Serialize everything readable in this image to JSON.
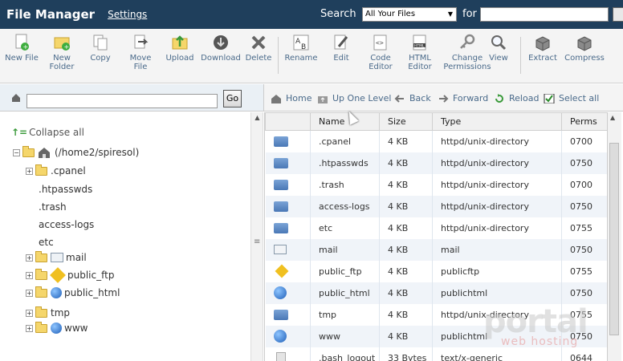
{
  "header": {
    "title": "File Manager",
    "settings": "Settings",
    "search_label": "Search",
    "search_scope": "All Your Files",
    "for_label": "for"
  },
  "toolbar": {
    "items": [
      {
        "label": "New File",
        "icon": "new-file-icon"
      },
      {
        "label": "New Folder",
        "icon": "new-folder-icon"
      },
      {
        "label": "Copy",
        "icon": "copy-icon"
      },
      {
        "label": "Move File",
        "icon": "move-icon"
      },
      {
        "label": "Upload",
        "icon": "upload-icon"
      },
      {
        "label": "Download",
        "icon": "download-icon"
      },
      {
        "label": "Delete",
        "icon": "delete-icon"
      },
      {
        "label": "Rename",
        "icon": "rename-icon"
      },
      {
        "label": "Edit",
        "icon": "edit-icon"
      },
      {
        "label": "Code Editor",
        "icon": "code-editor-icon"
      },
      {
        "label": "HTML Editor",
        "icon": "html-editor-icon"
      },
      {
        "label": "Change Permissions",
        "icon": "permissions-icon"
      },
      {
        "label": "View",
        "icon": "view-icon"
      },
      {
        "label": "Extract",
        "icon": "extract-icon"
      },
      {
        "label": "Compress",
        "icon": "compress-icon"
      }
    ]
  },
  "addressbar": {
    "go": "Go"
  },
  "nav": {
    "home": "Home",
    "up": "Up One Level",
    "back": "Back",
    "forward": "Forward",
    "reload": "Reload",
    "select_all": "Select all"
  },
  "tree": {
    "collapse_all": "Collapse all",
    "root": "(/home2/spiresol)",
    "items": [
      ".cpanel",
      ".htpasswds",
      ".trash",
      "access-logs",
      "etc",
      "mail",
      "public_ftp",
      "public_html",
      "tmp",
      "www"
    ]
  },
  "table": {
    "columns": [
      "Name",
      "Size",
      "Type",
      "Perms"
    ],
    "rows": [
      {
        "icon": "folder",
        "name": ".cpanel",
        "size": "4 KB",
        "type": "httpd/unix-directory",
        "perms": "0700"
      },
      {
        "icon": "folder",
        "name": ".htpasswds",
        "size": "4 KB",
        "type": "httpd/unix-directory",
        "perms": "0750"
      },
      {
        "icon": "folder",
        "name": ".trash",
        "size": "4 KB",
        "type": "httpd/unix-directory",
        "perms": "0700"
      },
      {
        "icon": "folder",
        "name": "access-logs",
        "size": "4 KB",
        "type": "httpd/unix-directory",
        "perms": "0750"
      },
      {
        "icon": "folder",
        "name": "etc",
        "size": "4 KB",
        "type": "httpd/unix-directory",
        "perms": "0755"
      },
      {
        "icon": "mail",
        "name": "mail",
        "size": "4 KB",
        "type": "mail",
        "perms": "0750"
      },
      {
        "icon": "ftp",
        "name": "public_ftp",
        "size": "4 KB",
        "type": "publicftp",
        "perms": "0755"
      },
      {
        "icon": "globe",
        "name": "public_html",
        "size": "4 KB",
        "type": "publichtml",
        "perms": "0750"
      },
      {
        "icon": "folder",
        "name": "tmp",
        "size": "4 KB",
        "type": "httpd/unix-directory",
        "perms": "0755"
      },
      {
        "icon": "globe",
        "name": "www",
        "size": "4 KB",
        "type": "publichtml",
        "perms": "0750"
      },
      {
        "icon": "file",
        "name": ".bash_logout",
        "size": "33 Bytes",
        "type": "text/x-generic",
        "perms": "0644"
      }
    ]
  },
  "watermark": {
    "main": "portal",
    "sub": "web hosting"
  },
  "colors": {
    "header_bg": "#1f3f5c",
    "link": "#4a6a8a",
    "row_alt": "#f0f4f9"
  }
}
